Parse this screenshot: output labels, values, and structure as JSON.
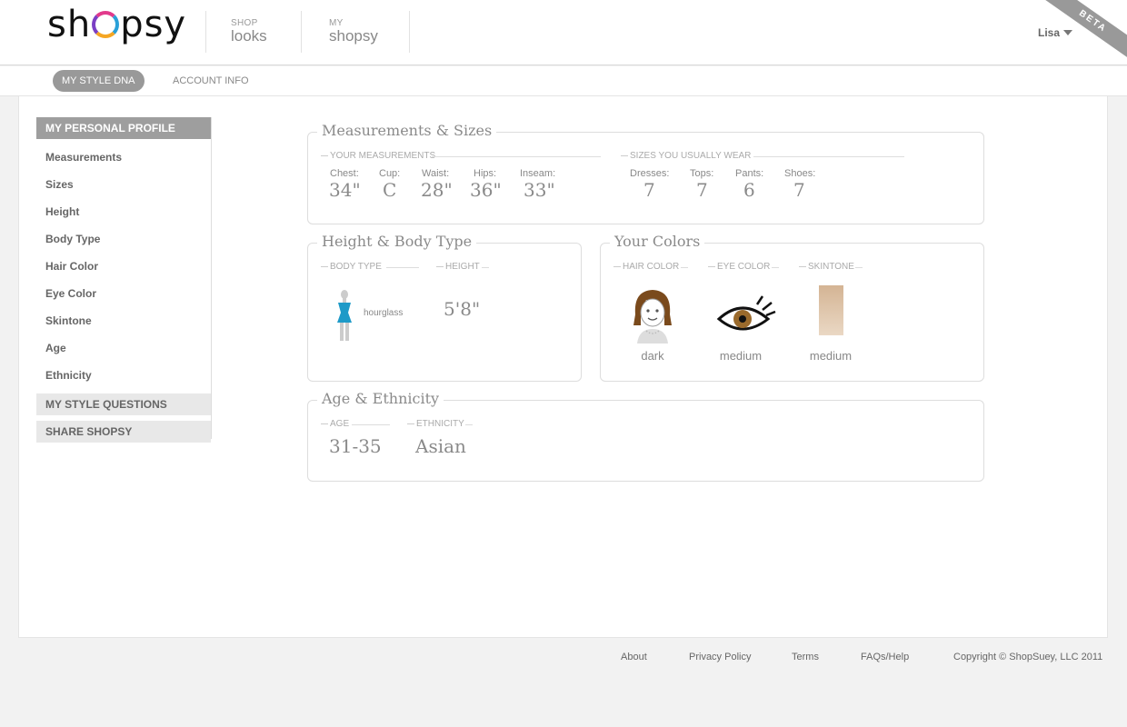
{
  "header": {
    "logo": {
      "before": "sh",
      "after": "psy"
    },
    "nav": [
      {
        "small": "SHOP",
        "big": "looks"
      },
      {
        "small": "MY",
        "big": "shopsy"
      }
    ],
    "user": "Lisa",
    "beta": "BETA"
  },
  "subnav": {
    "tabs": [
      "MY STYLE DNA",
      "ACCOUNT INFO"
    ],
    "active": "MY STYLE DNA"
  },
  "sidebar": {
    "profile_heading": "MY PERSONAL PROFILE",
    "items": [
      "Measurements",
      "Sizes",
      "Height",
      "Body Type",
      "Hair Color",
      "Eye Color",
      "Skintone",
      "Age",
      "Ethnicity"
    ],
    "style_questions": "MY STYLE QUESTIONS",
    "share": "SHARE SHOPSY"
  },
  "measurements": {
    "title": "Measurements & Sizes",
    "your_label": "YOUR MEASUREMENTS",
    "sizes_label": "SIZES YOU USUALLY WEAR",
    "items": [
      {
        "label": "Chest:",
        "value": "34\""
      },
      {
        "label": "Cup:",
        "value": "C"
      },
      {
        "label": "Waist:",
        "value": "28\""
      },
      {
        "label": "Hips:",
        "value": "36\""
      },
      {
        "label": "Inseam:",
        "value": "33\""
      }
    ],
    "sizes": [
      {
        "label": "Dresses:",
        "value": "7"
      },
      {
        "label": "Tops:",
        "value": "7"
      },
      {
        "label": "Pants:",
        "value": "6"
      },
      {
        "label": "Shoes:",
        "value": "7"
      }
    ]
  },
  "height_body": {
    "title": "Height & Body Type",
    "body_type_label": "BODY TYPE",
    "height_label": "HEIGHT",
    "body_type": "hourglass",
    "height": "5'8\""
  },
  "colors": {
    "title": "Your Colors",
    "hair_label": "HAIR COLOR",
    "eye_label": "EYE COLOR",
    "skin_label": "SKINTONE",
    "hair": "dark",
    "eye": "medium",
    "skin": "medium",
    "hair_swatch": "#7a4a1c",
    "eye_swatch": "#9a6a2c",
    "skin_swatch": "#dcc0a0"
  },
  "age_ethnicity": {
    "title": "Age & Ethnicity",
    "age_label": "AGE",
    "ethnicity_label": "ETHNICITY",
    "age": "31-35",
    "ethnicity": "Asian"
  },
  "footer": {
    "links": [
      "About",
      "Privacy Policy",
      "Terms",
      "FAQs/Help"
    ],
    "copyright": "Copyright © ShopSuey, LLC 2011"
  }
}
